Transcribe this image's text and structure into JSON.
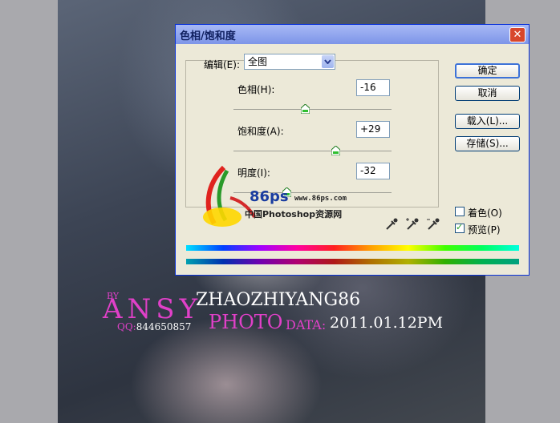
{
  "dialog": {
    "title": "色相/饱和度",
    "close_symbol": "✕",
    "edit": {
      "label": "编辑(E):",
      "selected": "全图"
    },
    "hue": {
      "label": "色相(H):",
      "value": "-16",
      "level": -16,
      "min": -180,
      "max": 180
    },
    "saturation": {
      "label": "饱和度(A):",
      "value": "+29",
      "level": 29,
      "min": -100,
      "max": 100
    },
    "lightness": {
      "label": "明度(I):",
      "value": "-32",
      "level": -32,
      "min": -100,
      "max": 100
    },
    "buttons": {
      "ok": "确定",
      "cancel": "取消",
      "load": "载入(L)...",
      "save": "存储(S)..."
    },
    "colorize": {
      "label": "着色(O)",
      "checked": false
    },
    "preview": {
      "label": "预览(P)",
      "checked": true
    },
    "eyedroppers": [
      "eyedropper-icon",
      "eyedropper-plus-icon",
      "eyedropper-minus-icon"
    ]
  },
  "logo": {
    "number": "86ps",
    "url": "www.86ps.com",
    "tagline": "中国Photoshop资源网"
  },
  "watermark": {
    "by": "BY",
    "author": "ANSY",
    "qq_label": "QQ:",
    "qq_number": "844650857",
    "name": "ZHAOZHIYANG86",
    "photo": "PHOTO",
    "data_label": "DATA:",
    "date": "2011.01.12PM"
  },
  "colors": {
    "accent_pink": "#e040c8",
    "title_bar": "#7d95e8",
    "dialog_bg": "#ece9d8"
  }
}
